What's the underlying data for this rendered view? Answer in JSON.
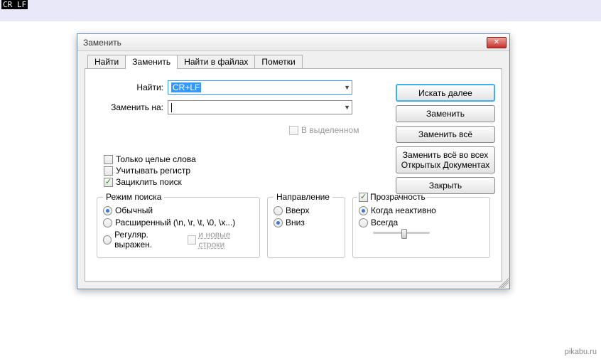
{
  "editor": {
    "line1": "CR LF"
  },
  "dialog": {
    "title": "Заменить",
    "tabs": [
      "Найти",
      "Заменить",
      "Найти в файлах",
      "Пометки"
    ],
    "activeTab": 1,
    "findLabel": "Найти:",
    "findValue": "CR+LF",
    "replaceLabel": "Заменить на:",
    "replaceValue": "",
    "inSelection": "В выделенном",
    "opts": {
      "wholeWord": "Только целые слова",
      "matchCase": "Учитывать регистр",
      "wrap": "Зациклить поиск"
    },
    "buttons": {
      "findNext": "Искать далее",
      "replace": "Заменить",
      "replaceAll": "Заменить всё",
      "replaceAllOpen": "Заменить всё во всех Открытых Документах",
      "close": "Закрыть"
    },
    "mode": {
      "title": "Режим поиска",
      "normal": "Обычный",
      "extended": "Расширенный (\\n, \\r, \\t, \\0, \\x...)",
      "regex": "Регуляр. выражен.",
      "newlines": "и новые строки"
    },
    "direction": {
      "title": "Направление",
      "up": "Вверх",
      "down": "Вниз"
    },
    "transparency": {
      "title": "Прозрачность",
      "onInactive": "Когда неактивно",
      "always": "Всегда"
    }
  },
  "watermark": "pikabu.ru"
}
